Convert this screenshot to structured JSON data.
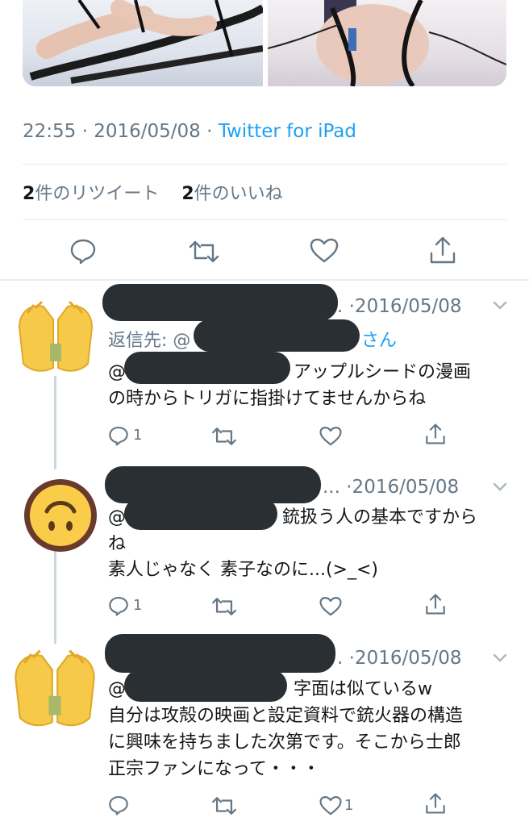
{
  "tweet": {
    "time": "22:55",
    "date": "2016/05/08",
    "source": "Twitter for iPad",
    "retweet_count": "2",
    "retweet_label": "件のリツイート",
    "like_count": "2",
    "like_label": "件のいいね"
  },
  "replies": [
    {
      "avatar_icon": "raised-hands-icon",
      "ellipsis": ".",
      "date": "·2016/05/08",
      "reply_to_label": "返信先: @",
      "reply_to_suffix": "さん",
      "mention_prefix": "@",
      "text_line1": "アップルシードの漫画",
      "text_line2": "の時からトリガに指掛けてませんからね",
      "reply_count": "1",
      "like_count": ""
    },
    {
      "avatar_icon": "upside-down-face-icon",
      "ellipsis": "...",
      "date": "·2016/05/08",
      "mention_prefix": "@",
      "text_line1": "銃扱う人の基本ですから",
      "text_line2": "ね",
      "text_line3": "素人じゃなく 素子なのに...(>_<)",
      "reply_count": "1",
      "like_count": ""
    },
    {
      "avatar_icon": "raised-hands-icon",
      "ellipsis": ".",
      "date": "·2016/05/08",
      "mention_prefix": "@",
      "text_line1": "字面は似ているw",
      "text_line2": "自分は攻殻の映画と設定資料で銃火器の構造",
      "text_line3": "に興味を持ちました次第です。そこから士郎",
      "text_line4": "正宗ファンになって・・・",
      "reply_count": "",
      "like_count": "1"
    }
  ],
  "colors": {
    "accent": "#1da1f2",
    "muted": "#657786",
    "divider": "#e6ecf0",
    "censor": "#2a2f33"
  }
}
